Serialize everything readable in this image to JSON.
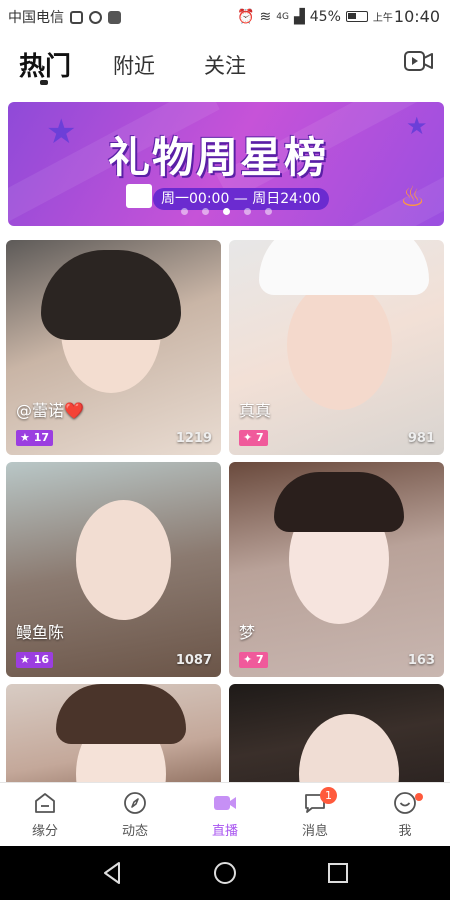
{
  "status": {
    "carrier": "中国电信",
    "battery": "45%",
    "time": "10:40",
    "ampm": "上午",
    "network": "4G"
  },
  "tabs": [
    {
      "label": "热门"
    },
    {
      "label": "附近"
    },
    {
      "label": "关注"
    }
  ],
  "banner": {
    "title": "礼物周星榜",
    "subtitle": "周一00:00 — 周日24:00",
    "slides": 5,
    "active_slide": 3
  },
  "cards": [
    {
      "name": "@蕾诺❤️",
      "level": "17",
      "count": "1219"
    },
    {
      "name": "真真",
      "level": "7",
      "count": "981"
    },
    {
      "name": "鳗鱼陈",
      "level": "16",
      "count": "1087"
    },
    {
      "name": "梦",
      "level": "7",
      "count": "163"
    },
    {
      "name": "",
      "level": "",
      "count": ""
    },
    {
      "name": "",
      "level": "",
      "count": ""
    }
  ],
  "nav": [
    {
      "label": "缘分"
    },
    {
      "label": "动态"
    },
    {
      "label": "直播"
    },
    {
      "label": "消息",
      "badge": "1"
    },
    {
      "label": "我"
    }
  ],
  "colors": {
    "accent": "#a855f0",
    "badge": "#ff5a3c"
  }
}
